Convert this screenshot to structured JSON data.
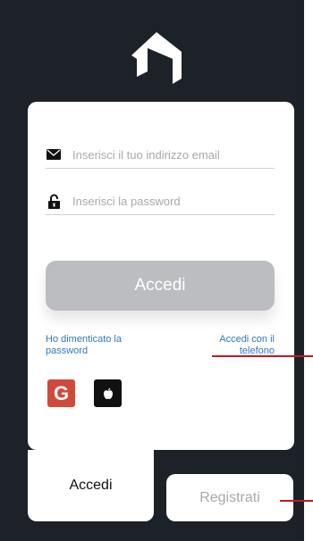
{
  "theme": {
    "background": "#1d2128",
    "card": "#ffffff",
    "link": "#2f79bf",
    "button": "#bcbdc1",
    "google": "#d04a3b",
    "apple": "#111111",
    "callout": "#c4181f"
  },
  "logo": {
    "icon": "house-logo-icon"
  },
  "form": {
    "email": {
      "icon": "mail-icon",
      "placeholder": "Inserisci il tuo indirizzo email",
      "value": ""
    },
    "password": {
      "icon": "lock-icon",
      "placeholder": "Inserisci la password",
      "value": ""
    },
    "login_label": "Accedi",
    "forgot_line1": "Ho dimenticato la",
    "forgot_line2": "password",
    "phone_line1": "Accedi con il",
    "phone_line2": "telefono",
    "social": {
      "google_label": "G",
      "google_icon": "google-icon",
      "apple_icon": "apple-icon"
    }
  },
  "tabs": {
    "login": "Accedi",
    "register": "Registrati"
  }
}
